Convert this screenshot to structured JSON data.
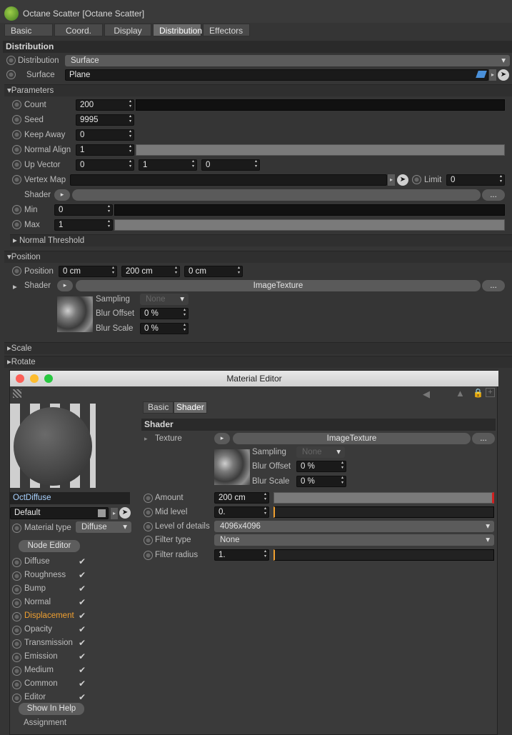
{
  "window": {
    "title": "Octane Scatter [Octane Scatter]"
  },
  "tabs": [
    "Basic",
    "Coord.",
    "Display",
    "Distribution",
    "Effectors"
  ],
  "active_tab": "Distribution",
  "distribution": {
    "header": "Distribution",
    "distribution_label": "Distribution",
    "distribution_value": "Surface",
    "surface_label": "Surface",
    "surface_value": "Plane"
  },
  "parameters": {
    "header": "Parameters",
    "count_label": "Count",
    "count_value": "200",
    "seed_label": "Seed",
    "seed_value": "9995",
    "keepaway_label": "Keep Away",
    "keepaway_value": "0",
    "normalalign_label": "Normal Align",
    "normalalign_value": "1",
    "upvector_label": "Up Vector",
    "upvector": [
      "0",
      "1",
      "0"
    ],
    "vertexmap_label": "Vertex Map",
    "limit_label": "Limit",
    "limit_value": "0",
    "shader_label": "Shader",
    "min_label": "Min",
    "min_value": "0",
    "max_label": "Max",
    "max_value": "1",
    "normal_threshold": "Normal Threshold"
  },
  "position": {
    "header": "Position",
    "position_label": "Position",
    "position": [
      "0 cm",
      "200 cm",
      "0 cm"
    ],
    "shader_label": "Shader",
    "shader_value": "ImageTexture",
    "sampling_label": "Sampling",
    "sampling_value": "None",
    "bluroffset_label": "Blur Offset",
    "bluroffset_value": "0 %",
    "blurscale_label": "Blur Scale",
    "blurscale_value": "0 %"
  },
  "scale": "Scale",
  "rotate": "Rotate",
  "material_editor": {
    "title": "Material Editor",
    "material_name": "OctDiffuse",
    "default_label": "Default",
    "material_type_label": "Material type",
    "material_type_value": "Diffuse",
    "node_editor": "Node Editor",
    "channels": [
      "Diffuse",
      "Roughness",
      "Bump",
      "Normal",
      "Displacement",
      "Opacity",
      "Transmission",
      "Emission",
      "Medium",
      "Common",
      "Editor"
    ],
    "active_channel": "Displacement",
    "show_in_help": "Show In Help",
    "assignment": "Assignment",
    "tabs": [
      "Basic",
      "Shader"
    ],
    "shader_header": "Shader",
    "texture_label": "Texture",
    "texture_value": "ImageTexture",
    "sampling_label": "Sampling",
    "sampling_value": "None",
    "bluroffset_label": "Blur Offset",
    "bluroffset_value": "0 %",
    "blurscale_label": "Blur Scale",
    "blurscale_value": "0 %",
    "amount_label": "Amount",
    "amount_value": "200 cm",
    "midlevel_label": "Mid level",
    "midlevel_value": "0.",
    "lod_label": "Level of details",
    "lod_value": "4096x4096",
    "filtertype_label": "Filter type",
    "filtertype_value": "None",
    "filterradius_label": "Filter radius",
    "filterradius_value": "1.",
    "ellipsis": "..."
  },
  "colors": {
    "accent_orange": "#f0a030",
    "field_text": "#e8e8e8",
    "name_blue": "#a9d2ff"
  }
}
